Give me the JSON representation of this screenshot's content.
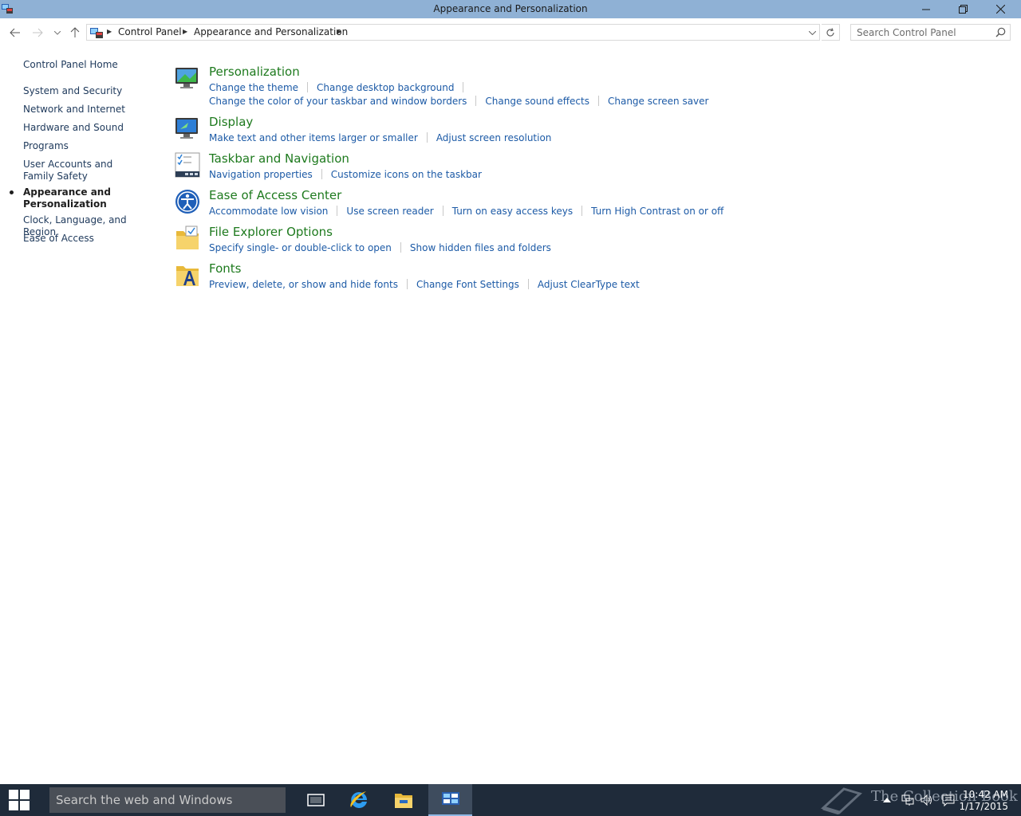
{
  "window": {
    "title": "Appearance and Personalization"
  },
  "address": {
    "crumbs": [
      "Control Panel",
      "Appearance and Personalization"
    ]
  },
  "search": {
    "placeholder": "Search Control Panel"
  },
  "leftnav": {
    "home": "Control Panel Home",
    "items": [
      "System and Security",
      "Network and Internet",
      "Hardware and Sound",
      "Programs",
      "User Accounts and Family Safety",
      "Appearance and Personalization",
      "Clock, Language, and Region",
      "Ease of Access"
    ],
    "current_index": 5
  },
  "categories": [
    {
      "title": "Personalization",
      "icon": "personalization-icon",
      "rows": [
        [
          "Change the theme",
          "Change desktop background"
        ],
        [
          "Change the color of your taskbar and window borders",
          "Change sound effects",
          "Change screen saver"
        ]
      ]
    },
    {
      "title": "Display",
      "icon": "display-icon",
      "rows": [
        [
          "Make text and other items larger or smaller",
          "Adjust screen resolution"
        ]
      ]
    },
    {
      "title": "Taskbar and Navigation",
      "icon": "taskbar-icon",
      "rows": [
        [
          "Navigation properties",
          "Customize icons on the taskbar"
        ]
      ]
    },
    {
      "title": "Ease of Access Center",
      "icon": "ease-of-access-icon",
      "rows": [
        [
          "Accommodate low vision",
          "Use screen reader",
          "Turn on easy access keys",
          "Turn High Contrast on or off"
        ]
      ]
    },
    {
      "title": "File Explorer Options",
      "icon": "folder-options-icon",
      "rows": [
        [
          "Specify single- or double-click to open",
          "Show hidden files and folders"
        ]
      ]
    },
    {
      "title": "Fonts",
      "icon": "fonts-folder-icon",
      "rows": [
        [
          "Preview, delete, or show and hide fonts",
          "Change Font Settings",
          "Adjust ClearType text"
        ]
      ]
    }
  ],
  "taskbar": {
    "search_placeholder": "Search the web and Windows",
    "watermark": "The Collection Book",
    "time": "10:42 AM",
    "date": "1/17/2015"
  },
  "colors": {
    "titlebar": "#8fb1d5",
    "category_title": "#1e7a1e",
    "link": "#1c5aa6",
    "taskbar": "#1f2b3a"
  }
}
